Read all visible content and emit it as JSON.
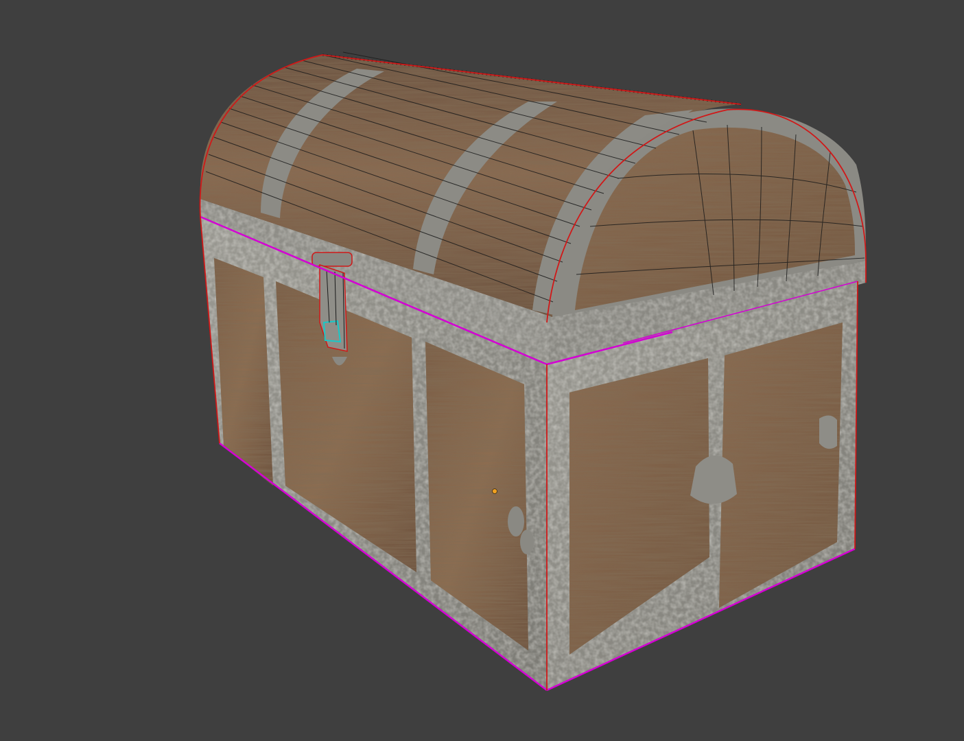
{
  "viewport": {
    "background": "#3f3f3f",
    "object": "treasure-chest",
    "selection_edge_color": "#d400d4",
    "seam_edge_color": "#d01818",
    "active_edge_color": "#18c8c8",
    "wireframe_color": "#1a1a1a",
    "origin_color": "#f0a020"
  },
  "materials": {
    "wood_light": "#8a6a4e",
    "wood_dark": "#5e4634",
    "iron": "#8e8d86",
    "iron_dark": "#6a6963"
  }
}
